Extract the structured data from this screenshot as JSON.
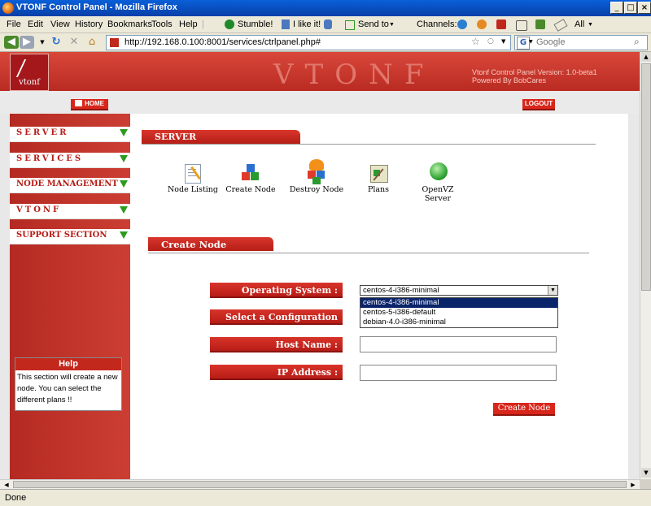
{
  "window": {
    "title": "VTONF Control Panel - Mozilla Firefox"
  },
  "menu": [
    "File",
    "Edit",
    "View",
    "History",
    "Bookmarks",
    "Tools",
    "Help"
  ],
  "toolbar": {
    "stumble": "Stumble!",
    "ilike": "I like it!",
    "sendto": "Send to",
    "channels": "Channels:",
    "all": "All"
  },
  "nav": {
    "url": "http://192.168.0.100:8001/services/ctrlpanel.php#",
    "search_placeholder": "Google"
  },
  "banner": {
    "logo_text": "vtonf",
    "brand": "VTONF",
    "version": "Vtonf Control Panel Version: 1.0-beta1",
    "powered": "Powered By BobCares"
  },
  "top_buttons": {
    "home": "HOME",
    "logout": "LOGOUT"
  },
  "sidebar": {
    "items": [
      {
        "label": "SERVER"
      },
      {
        "label": "SERVICES"
      },
      {
        "label": "NODE MANAGEMENT"
      },
      {
        "label": "VTONF"
      },
      {
        "label": "SUPPORT SECTION"
      }
    ],
    "help_title": "Help",
    "help_text": "This section will create a new node. You can select the different plans !!"
  },
  "server_section": {
    "title": "SERVER",
    "icons": [
      {
        "label": "Node Listing"
      },
      {
        "label": "Create Node"
      },
      {
        "label": "Destroy Node"
      },
      {
        "label": "Plans"
      },
      {
        "label": "OpenVZ Server"
      }
    ]
  },
  "create_section": {
    "title": "Create Node",
    "os_label": "Operating System :",
    "config_label": "Select a Configuration file:",
    "host_label": "Host Name :",
    "ip_label": "IP Address :",
    "os_selected": "centos-4-i386-minimal",
    "os_options": [
      "centos-4-i386-minimal",
      "centos-5-i386-default",
      "debian-4.0-i386-minimal"
    ],
    "submit": "Create Node"
  },
  "status": {
    "text": "Done"
  },
  "colors": {
    "brand_red": "#c3281d",
    "accent_green": "#2e9a20",
    "selection_blue": "#0a246a"
  }
}
